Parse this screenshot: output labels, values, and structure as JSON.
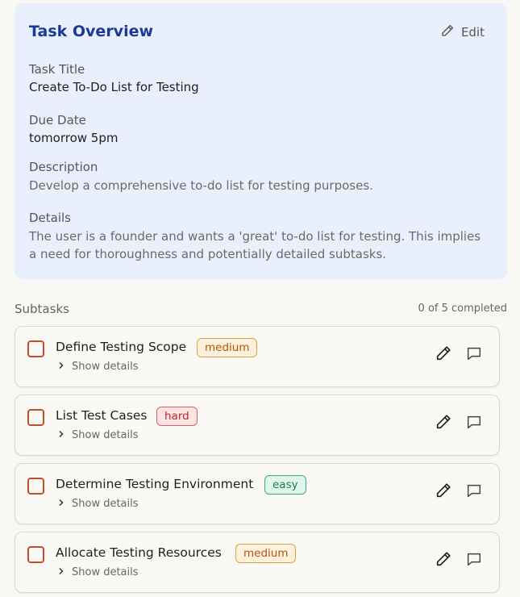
{
  "overview": {
    "title": "Task Overview",
    "edit_label": "Edit",
    "fields": {
      "task_title_label": "Task Title",
      "task_title_value": "Create To-Do List for Testing",
      "due_date_label": "Due Date",
      "due_date_value": "tomorrow 5pm",
      "description_label": "Description",
      "description_value": "Develop a comprehensive to-do list for testing purposes.",
      "details_label": "Details",
      "details_value": "The user is a founder and wants a 'great' to-do list for testing. This implies a need for thoroughness and potentially detailed subtasks."
    }
  },
  "subtasks": {
    "label": "Subtasks",
    "count_text": "0 of 5 completed",
    "show_details_label": "Show details",
    "items": [
      {
        "name": "Define Testing Scope",
        "difficulty": "medium"
      },
      {
        "name": "List Test Cases",
        "difficulty": "hard"
      },
      {
        "name": "Determine Testing Environment",
        "difficulty": "easy"
      },
      {
        "name": "Allocate Testing Resources",
        "difficulty": "medium"
      }
    ]
  },
  "colors": {
    "overview_bg": "#e9effc",
    "title_blue": "#1a3a9a",
    "checkbox_border": "#c0502a",
    "badge_medium": "#b0560b",
    "badge_hard": "#b22a2a",
    "badge_easy": "#1f7a55"
  },
  "icons": {
    "edit": "pencil-icon",
    "comment": "comment-icon",
    "chevron": "chevron-right-icon"
  }
}
